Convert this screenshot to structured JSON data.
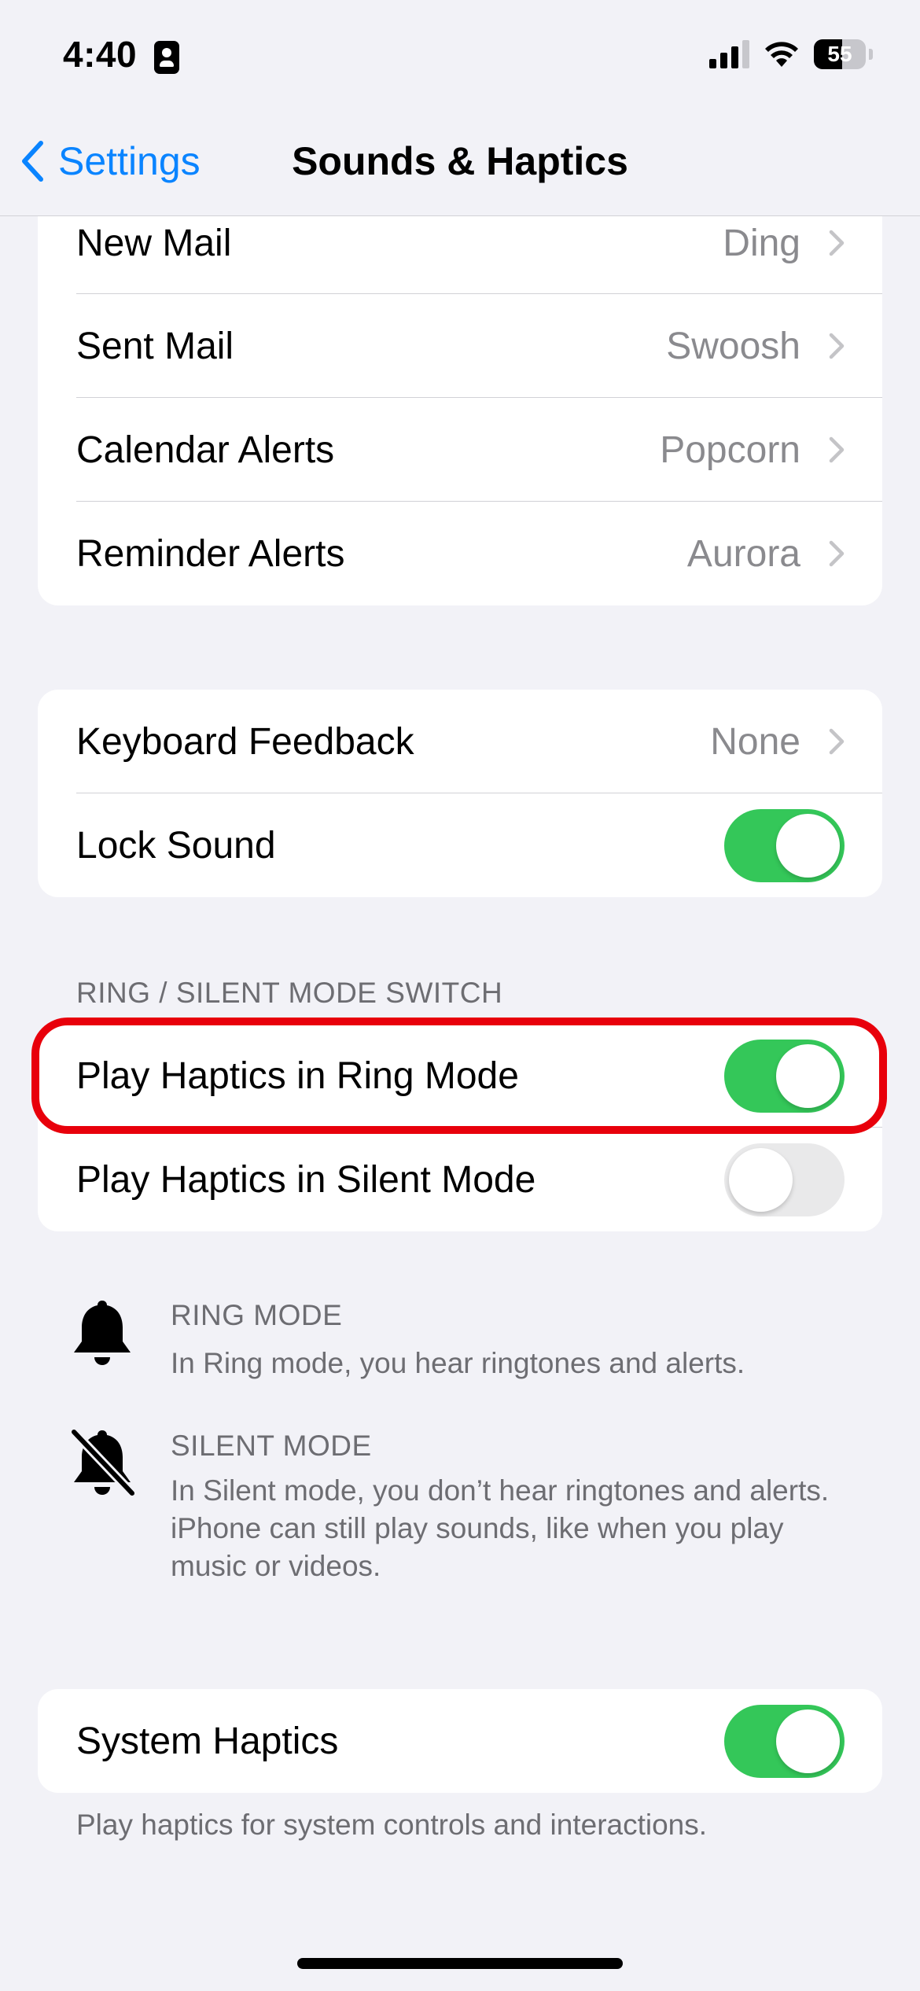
{
  "status": {
    "time": "4:40",
    "battery": "55",
    "battery_fill": 0.55
  },
  "nav": {
    "back_label": "Settings",
    "title": "Sounds & Haptics"
  },
  "alerts_group": [
    {
      "label": "New Mail",
      "value": "Ding"
    },
    {
      "label": "Sent Mail",
      "value": "Swoosh"
    },
    {
      "label": "Calendar Alerts",
      "value": "Popcorn"
    },
    {
      "label": "Reminder Alerts",
      "value": "Aurora"
    }
  ],
  "feedback_group": {
    "keyboard_label": "Keyboard Feedback",
    "keyboard_value": "None",
    "lock_label": "Lock Sound",
    "lock_on": true
  },
  "ring_silent": {
    "header": "RING / SILENT MODE SWITCH",
    "ring_label": "Play Haptics in Ring Mode",
    "ring_on": true,
    "silent_label": "Play Haptics in Silent Mode",
    "silent_on": false
  },
  "info": {
    "ring_title": "RING MODE",
    "ring_text": "In Ring mode, you hear ringtones and alerts.",
    "silent_title": "SILENT MODE",
    "silent_text": "In Silent mode, you don’t hear ringtones and alerts. iPhone can still play sounds, like when you play music or videos."
  },
  "system": {
    "label": "System Haptics",
    "on": true,
    "footer": "Play haptics for system controls and interactions."
  },
  "colors": {
    "accent": "#0a84ff",
    "toggle_on": "#34c759",
    "highlight": "#e8000b"
  },
  "icons": {
    "back": "chevron-left-icon",
    "disclosure": "chevron-right-icon",
    "ring": "bell-icon",
    "silent": "bell-slash-icon"
  }
}
